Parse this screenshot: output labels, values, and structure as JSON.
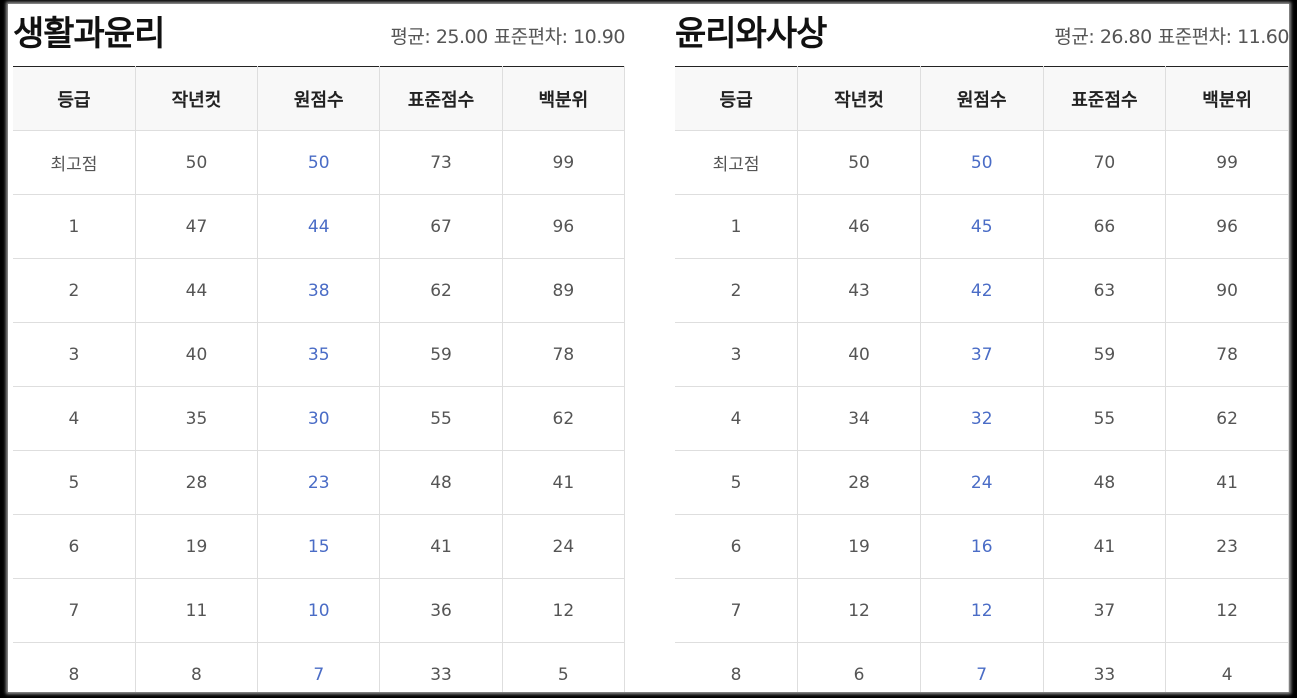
{
  "panels": [
    {
      "subject": "생활과윤리",
      "mean_label": "평균:",
      "mean": "25.00",
      "sd_label": "표준편차:",
      "sd": "10.90",
      "headers": [
        "등급",
        "작년컷",
        "원점수",
        "표준점수",
        "백분위"
      ],
      "rows": [
        [
          "최고점",
          "50",
          "50",
          "73",
          "99"
        ],
        [
          "1",
          "47",
          "44",
          "67",
          "96"
        ],
        [
          "2",
          "44",
          "38",
          "62",
          "89"
        ],
        [
          "3",
          "40",
          "35",
          "59",
          "78"
        ],
        [
          "4",
          "35",
          "30",
          "55",
          "62"
        ],
        [
          "5",
          "28",
          "23",
          "48",
          "41"
        ],
        [
          "6",
          "19",
          "15",
          "41",
          "24"
        ],
        [
          "7",
          "11",
          "10",
          "36",
          "12"
        ],
        [
          "8",
          "8",
          "7",
          "33",
          "5"
        ]
      ]
    },
    {
      "subject": "윤리와사상",
      "mean_label": "평균:",
      "mean": "26.80",
      "sd_label": "표준편차:",
      "sd": "11.60",
      "headers": [
        "등급",
        "작년컷",
        "원점수",
        "표준점수",
        "백분위"
      ],
      "rows": [
        [
          "최고점",
          "50",
          "50",
          "70",
          "99"
        ],
        [
          "1",
          "46",
          "45",
          "66",
          "96"
        ],
        [
          "2",
          "43",
          "42",
          "63",
          "90"
        ],
        [
          "3",
          "40",
          "37",
          "59",
          "78"
        ],
        [
          "4",
          "34",
          "32",
          "55",
          "62"
        ],
        [
          "5",
          "28",
          "24",
          "48",
          "41"
        ],
        [
          "6",
          "19",
          "16",
          "41",
          "23"
        ],
        [
          "7",
          "12",
          "12",
          "37",
          "12"
        ],
        [
          "8",
          "6",
          "7",
          "33",
          "4"
        ]
      ]
    }
  ],
  "colors": {
    "raw_score": "#4a6cc6",
    "header_bg": "#f8f8f8",
    "grid": "#dedede"
  }
}
